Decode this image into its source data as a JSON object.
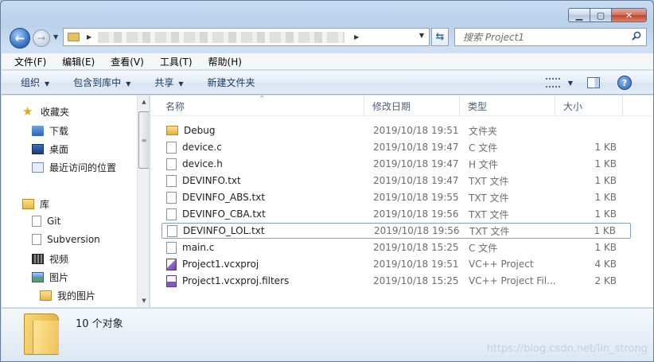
{
  "window": {
    "caption_minimize": "▁",
    "caption_maximize": "▢",
    "caption_close": "✕"
  },
  "address": {
    "path_hidden": true
  },
  "search": {
    "placeholder": "搜索 Project1"
  },
  "menu": {
    "items": [
      "文件(F)",
      "编辑(E)",
      "查看(V)",
      "工具(T)",
      "帮助(H)"
    ]
  },
  "toolbar": {
    "organize": "组织",
    "include_library": "包含到库中",
    "share": "共享",
    "new_folder": "新建文件夹"
  },
  "navpane": {
    "favorites": "收藏夹",
    "downloads": "下载",
    "desktop": "桌面",
    "recent": "最近访问的位置",
    "libraries": "库",
    "git": "Git",
    "subversion": "Subversion",
    "videos": "视频",
    "pictures": "图片",
    "my_pictures": "我的图片"
  },
  "columns": {
    "name": "名称",
    "date": "修改日期",
    "type": "类型",
    "size": "大小"
  },
  "files": [
    {
      "name": "Debug",
      "date": "2019/10/18 19:51",
      "type": "文件夹",
      "size": "",
      "icon": "folder-icon"
    },
    {
      "name": "device.c",
      "date": "2019/10/18 19:47",
      "type": "C 文件",
      "size": "1 KB",
      "icon": "file-icon"
    },
    {
      "name": "device.h",
      "date": "2019/10/18 19:47",
      "type": "H 文件",
      "size": "1 KB",
      "icon": "file-icon"
    },
    {
      "name": "DEVINFO.txt",
      "date": "2019/10/18 19:47",
      "type": "TXT 文件",
      "size": "1 KB",
      "icon": "file-icon"
    },
    {
      "name": "DEVINFO_ABS.txt",
      "date": "2019/10/18 19:55",
      "type": "TXT 文件",
      "size": "1 KB",
      "icon": "file-icon"
    },
    {
      "name": "DEVINFO_CBA.txt",
      "date": "2019/10/18 19:56",
      "type": "TXT 文件",
      "size": "1 KB",
      "icon": "file-icon"
    },
    {
      "name": "DEVINFO_LOL.txt",
      "date": "2019/10/18 19:56",
      "type": "TXT 文件",
      "size": "1 KB",
      "icon": "file-icon"
    },
    {
      "name": "main.c",
      "date": "2019/10/18 15:25",
      "type": "C 文件",
      "size": "1 KB",
      "icon": "file-icon"
    },
    {
      "name": "Project1.vcxproj",
      "date": "2019/10/18 19:51",
      "type": "VC++ Project",
      "size": "4 KB",
      "icon": "vcxproj-icon"
    },
    {
      "name": "Project1.vcxproj.filters",
      "date": "2019/10/18 15:25",
      "type": "VC++ Project Fil...",
      "size": "2 KB",
      "icon": "filters-icon"
    }
  ],
  "details": {
    "count": "10 个对象"
  },
  "watermark": "https://blog.csdn.net/lin_strong"
}
